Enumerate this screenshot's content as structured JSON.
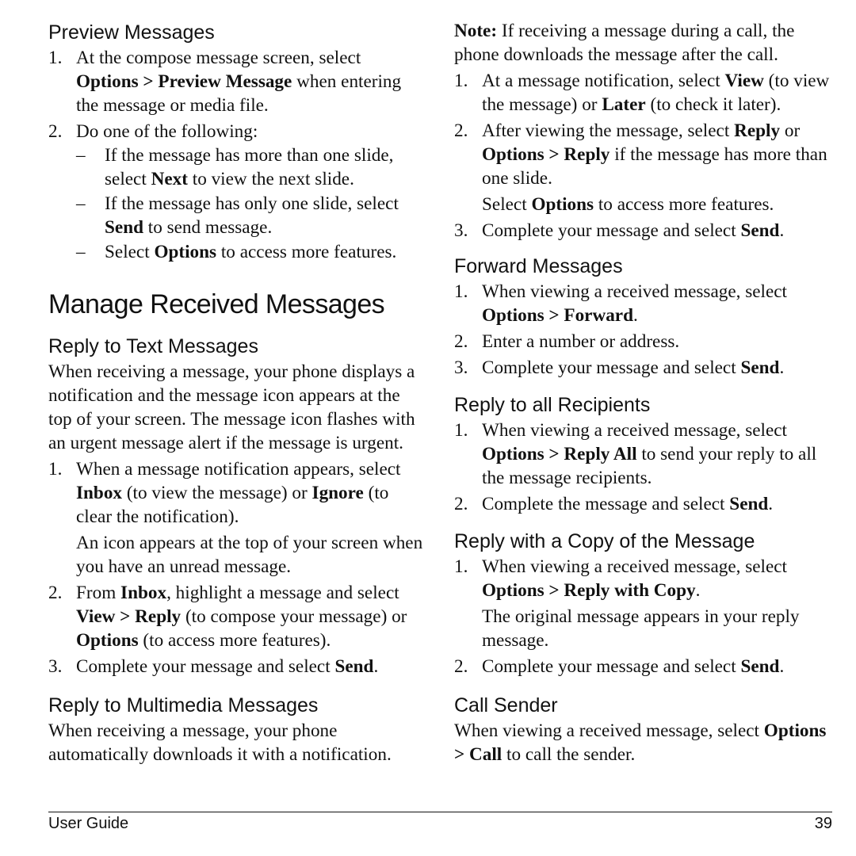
{
  "left": {
    "preview": {
      "heading": "Preview Messages",
      "steps": [
        {
          "num": "1.",
          "text": [
            {
              "t": "At the compose message screen, select "
            },
            {
              "b": "Options > Preview Message"
            },
            {
              "t": " when entering the message or media file."
            }
          ]
        },
        {
          "num": "2.",
          "text": [
            {
              "t": "Do one of the following:"
            }
          ],
          "sub": [
            {
              "mark": "–",
              "text": [
                {
                  "t": "If the message has more than one slide, select "
                },
                {
                  "b": "Next"
                },
                {
                  "t": " to view the next slide."
                }
              ]
            },
            {
              "mark": "–",
              "text": [
                {
                  "t": "If the message has only one slide, select "
                },
                {
                  "b": "Send"
                },
                {
                  "t": " to send message."
                }
              ]
            },
            {
              "mark": "–",
              "text": [
                {
                  "t": "Select "
                },
                {
                  "b": "Options"
                },
                {
                  "t": " to access more features."
                }
              ]
            }
          ]
        }
      ]
    },
    "main_heading": "Manage Received Messages",
    "reply_text": {
      "heading": "Reply to Text Messages",
      "intro": "When receiving a message, your phone displays a notification and the message icon appears at the top of your screen. The message icon flashes with an urgent message alert if the message is urgent.",
      "steps": [
        {
          "num": "1.",
          "text": [
            {
              "t": "When a message notification appears, select "
            },
            {
              "b": "Inbox"
            },
            {
              "t": " (to view the message) or "
            },
            {
              "b": "Ignore"
            },
            {
              "t": " (to clear the notification)."
            }
          ],
          "note": [
            {
              "t": "An icon appears at the top of your screen when you have an unread message."
            }
          ]
        },
        {
          "num": "2.",
          "text": [
            {
              "t": "From "
            },
            {
              "b": "Inbox"
            },
            {
              "t": ", highlight a message and select "
            },
            {
              "b": "View > Reply"
            },
            {
              "t": " (to compose your message) or "
            },
            {
              "b": "Options"
            },
            {
              "t": " (to access more features)."
            }
          ]
        },
        {
          "num": "3.",
          "text": [
            {
              "t": "Complete your message and select "
            },
            {
              "b": "Send"
            },
            {
              "t": "."
            }
          ]
        }
      ]
    },
    "reply_mms": {
      "heading": "Reply to Multimedia Messages",
      "intro": "When receiving a message, your phone automatically downloads it with a notification."
    }
  },
  "right": {
    "note": [
      {
        "b": "Note:"
      },
      {
        "t": " If receiving a message during a call, the phone downloads the message after the call."
      }
    ],
    "note_steps": [
      {
        "num": "1.",
        "text": [
          {
            "t": "At a message notification, select "
          },
          {
            "b": "View"
          },
          {
            "t": " (to view the message) or "
          },
          {
            "b": "Later"
          },
          {
            "t": " (to check it later)."
          }
        ]
      },
      {
        "num": "2.",
        "text": [
          {
            "t": "After viewing the message, select "
          },
          {
            "b": "Reply"
          },
          {
            "t": " or "
          },
          {
            "b": "Options > Reply"
          },
          {
            "t": " if the message has more than one slide."
          }
        ],
        "note": [
          {
            "t": "Select "
          },
          {
            "b": "Options"
          },
          {
            "t": " to access more features."
          }
        ]
      },
      {
        "num": "3.",
        "text": [
          {
            "t": "Complete your message and select "
          },
          {
            "b": "Send"
          },
          {
            "t": "."
          }
        ]
      }
    ],
    "forward": {
      "heading": "Forward Messages",
      "steps": [
        {
          "num": "1.",
          "text": [
            {
              "t": "When viewing a received message, select "
            },
            {
              "b": "Options > Forward"
            },
            {
              "t": "."
            }
          ]
        },
        {
          "num": "2.",
          "text": [
            {
              "t": "Enter a number or address."
            }
          ]
        },
        {
          "num": "3.",
          "text": [
            {
              "t": "Complete your message and select "
            },
            {
              "b": "Send"
            },
            {
              "t": "."
            }
          ]
        }
      ]
    },
    "reply_all": {
      "heading": "Reply to all Recipients",
      "steps": [
        {
          "num": "1.",
          "text": [
            {
              "t": "When viewing a received message, select "
            },
            {
              "b": "Options > Reply All"
            },
            {
              "t": " to send your reply to all the message recipients."
            }
          ]
        },
        {
          "num": "2.",
          "text": [
            {
              "t": "Complete the message and select "
            },
            {
              "b": "Send"
            },
            {
              "t": "."
            }
          ]
        }
      ]
    },
    "reply_copy": {
      "heading": "Reply with a Copy of the Message",
      "steps": [
        {
          "num": "1.",
          "text": [
            {
              "t": "When viewing a received message, select "
            },
            {
              "b": "Options > Reply with Copy"
            },
            {
              "t": "."
            }
          ],
          "note": [
            {
              "t": "The original message appears in your reply message."
            }
          ]
        },
        {
          "num": "2.",
          "text": [
            {
              "t": "Complete your message and select "
            },
            {
              "b": "Send"
            },
            {
              "t": "."
            }
          ]
        }
      ]
    },
    "call_sender": {
      "heading": "Call Sender",
      "text": [
        {
          "t": "When viewing a received message, select "
        },
        {
          "b": "Options > Call"
        },
        {
          "t": " to call the sender."
        }
      ]
    }
  },
  "footer": {
    "title": "User Guide",
    "page_number": "39"
  }
}
